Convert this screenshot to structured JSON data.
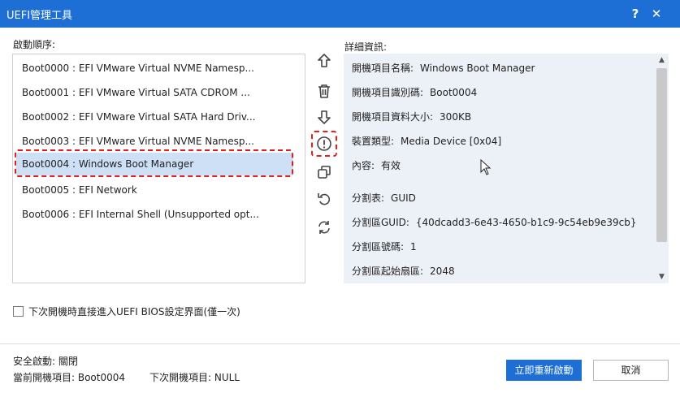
{
  "window": {
    "title": "UEFI管理工具",
    "help_label": "?",
    "close_label": "✕"
  },
  "boot_order": {
    "label": "啟動順序:",
    "items": [
      "Boot0000 : EFI VMware Virtual NVME Namesp...",
      "Boot0001 : EFI VMware Virtual SATA CDROM ...",
      "Boot0002 : EFI VMware Virtual SATA Hard Driv...",
      "Boot0003 : EFI VMware Virtual NVME Namesp...",
      "Boot0004 : Windows Boot Manager",
      "Boot0005 : EFI Network",
      "Boot0006 : EFI Internal Shell (Unsupported opt..."
    ],
    "selected_index": 4
  },
  "actions": {
    "icons": [
      "move-up-icon",
      "delete-icon",
      "move-down-icon",
      "info-icon",
      "duplicate-icon",
      "restore-icon",
      "refresh-icon"
    ]
  },
  "details": {
    "label": "詳細資訊:",
    "rows": [
      {
        "key": "開機項目名稱:",
        "value": "Windows Boot Manager"
      },
      {
        "key": "開機項目識別碼:",
        "value": "Boot0004"
      },
      {
        "key": "開機項目資料大小:",
        "value": "300KB"
      },
      {
        "key": "裝置類型:",
        "value": "Media Device [0x04]"
      },
      {
        "key": "內容:",
        "value": "有效"
      },
      {
        "key": "分割表:",
        "value": "GUID"
      },
      {
        "key": "分割區GUID:",
        "value": "{40dcadd3-6e43-4650-b1c9-9c54eb9e39cb}"
      },
      {
        "key": "分割區號碼:",
        "value": "1"
      },
      {
        "key": "分割區起始扇區:",
        "value": "2048"
      }
    ]
  },
  "checkbox": {
    "label": "下次開機時直接進入UEFI BIOS設定界面(僅一次)",
    "checked": false
  },
  "status": {
    "secure_boot": "安全啟動: 關閉",
    "current_boot": "當前開機項目: Boot0004",
    "next_boot": "下次開機項目: NULL"
  },
  "buttons": {
    "reboot": "立即重新啟動",
    "cancel": "取消"
  },
  "colors": {
    "accent": "#1d6fd6",
    "highlight": "#e0211f",
    "selection": "#cde0f5",
    "details_bg": "#ecf0f7"
  }
}
